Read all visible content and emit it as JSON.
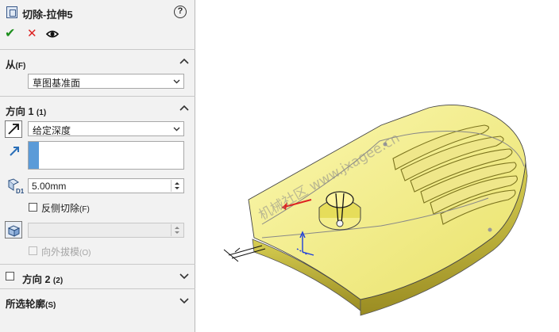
{
  "feature": {
    "title": "切除-拉伸5",
    "help_icon": "?",
    "ok_icon": "✔",
    "cancel_icon": "✕",
    "preview_icon": "eye-icon"
  },
  "from_section": {
    "title": "从",
    "shortcut": "(F)",
    "start_condition": "草图基准面"
  },
  "direction1_section": {
    "title": "方向 1",
    "shortcut": "(1)",
    "end_condition": "给定深度",
    "depth_value": "5.00mm",
    "flip_side_label": "反侧切除",
    "flip_side_shortcut": "(F)",
    "flip_side_checked": false,
    "draft_label": "向外拔模",
    "draft_shortcut": "(O)",
    "draft_checked": false
  },
  "direction2_section": {
    "title": "方向 2",
    "shortcut": "(2)",
    "checked": false
  },
  "selected_contours_section": {
    "title": "所选轮廓",
    "shortcut": "(S)"
  },
  "viewport": {
    "watermark": "机械社区 www.jxagee.cn",
    "model_color": "#f4f08a",
    "dim_label": "D1"
  }
}
